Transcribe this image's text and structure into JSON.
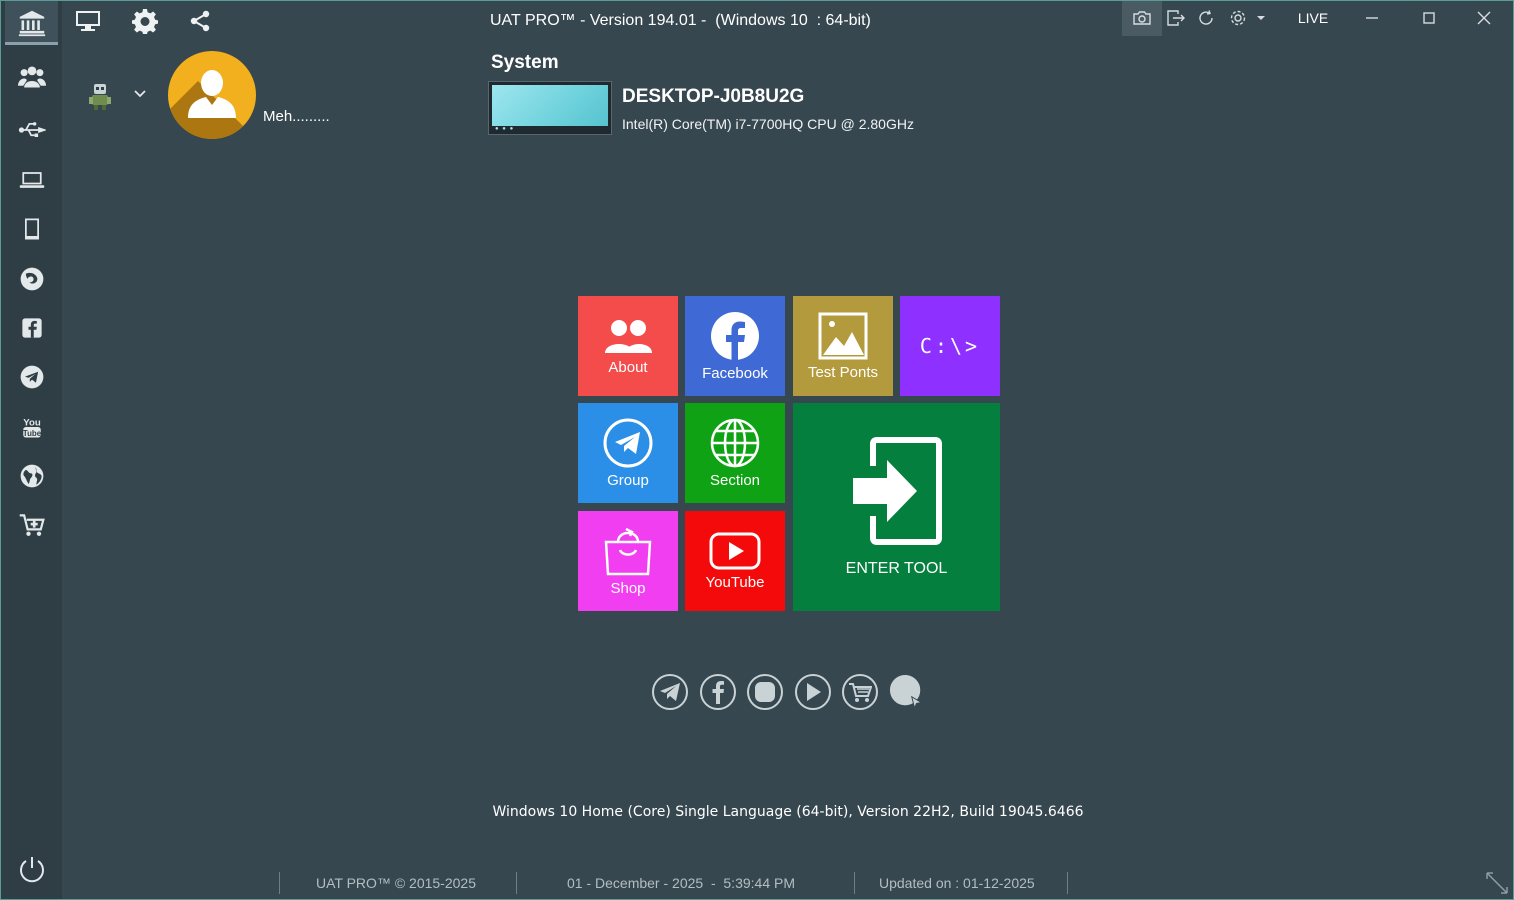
{
  "window": {
    "title": "UAT PRO™ - Version 194.01 -  (Windows 10  : 64-bit)",
    "live_label": "LIVE"
  },
  "sidebar": {
    "items": [
      {
        "icon": "bank-icon",
        "active": true
      },
      {
        "icon": "users-group-icon"
      },
      {
        "icon": "usb-icon"
      },
      {
        "icon": "laptop-icon"
      },
      {
        "icon": "tablet-icon"
      },
      {
        "icon": "firefox-icon"
      },
      {
        "icon": "facebook-icon"
      },
      {
        "icon": "telegram-icon"
      },
      {
        "icon": "youtube-icon"
      },
      {
        "icon": "globe-icon"
      },
      {
        "icon": "cart-add-icon"
      }
    ],
    "footer_icon": "power-icon"
  },
  "toolbar": {
    "icons": [
      "monitor-icon",
      "gear-icon",
      "share-icon"
    ],
    "window_tools": [
      "camera-icon",
      "exit-icon",
      "refresh-icon",
      "settings-dropdown-icon"
    ]
  },
  "profile": {
    "username": "Meh........."
  },
  "system": {
    "label": "System",
    "hostname": "DESKTOP-J0B8U2G",
    "cpu": "Intel(R) Core(TM) i7-7700HQ CPU @ 2.80GHz",
    "os_info": "Windows 10 Home (Core) Single Language (64-bit), Version 22H2, Build 19045.6466"
  },
  "tiles": {
    "about": {
      "label": "About",
      "color": "#f44b4b"
    },
    "facebook": {
      "label": "Facebook",
      "color": "#3f69d4"
    },
    "test_points": {
      "label": "Test Ponts",
      "color": "#b39a3c"
    },
    "cmd": {
      "label": "C:\\>",
      "color": "#8e30ff"
    },
    "group": {
      "label": "Group",
      "color": "#2b8fe8"
    },
    "section": {
      "label": "Section",
      "color": "#0fa214"
    },
    "enter_tool": {
      "label": "ENTER TOOL",
      "color": "#047f3e"
    },
    "shop": {
      "label": "Shop",
      "color": "#f03ef0"
    },
    "youtube": {
      "label": "YouTube",
      "color": "#f40a0a"
    }
  },
  "social_links": [
    "telegram-icon",
    "facebook-icon",
    "instagram-icon",
    "play-icon",
    "cart-icon",
    "web-icon"
  ],
  "status_bar": {
    "copyright": "UAT PRO™ © 2015-2025",
    "datetime": "01 - December - 2025  -  5:39:44 PM",
    "updated": "Updated on : 01-12-2025"
  }
}
